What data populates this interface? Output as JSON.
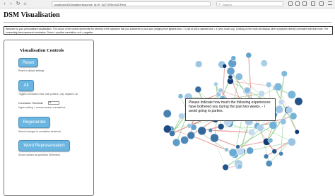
{
  "browser": {
    "url": "localhost:5000/static/response_id=R_0A7T0Rez43CPbyt",
    "search_placeholder": "Search"
  },
  "page": {
    "title": "DSM Visualisation",
    "description": "Welcome to your personalised visualisation. The colour of the nodes represents the severity of the symptom that you answered in your quiz (ranging from lightest blue = 0 (not at all) to darkest blue = 4 (very much so)). Clicking on the node will display other symptoms directly correlated with that node. The connecting lines represent correlation. Green = positive correlation, red = negative."
  },
  "controls": {
    "heading": "Visualisation Controls",
    "reset_label": "Reset",
    "reset_help": "Reset to default settings",
    "all_label": "All",
    "all_help": "Toggles correlation view: side positive, only negative, all",
    "threshold_label": "Correlation Threshold",
    "threshold_value": "0",
    "threshold_help": "Higher setting = remove weaker correlations",
    "regenerate_label": "Regenerate",
    "regenerate_help": "Submit changes to correlation threshold",
    "word_label": "Word Representation",
    "word_help": "Shows options as questions (Selection)"
  },
  "tooltip": {
    "text": "Please indicate how much the following experiences have bothered you during the past two weeks. - I avoid going to parties."
  },
  "colors": {
    "node_light": "#c6dbef",
    "node_mid": "#6baed6",
    "node_dark": "#08306b",
    "edge_positive": "#7cc47c",
    "edge_negative": "#e07a7a",
    "button_bg": "#6ab6e0"
  },
  "network": {
    "node_count": 90
  }
}
